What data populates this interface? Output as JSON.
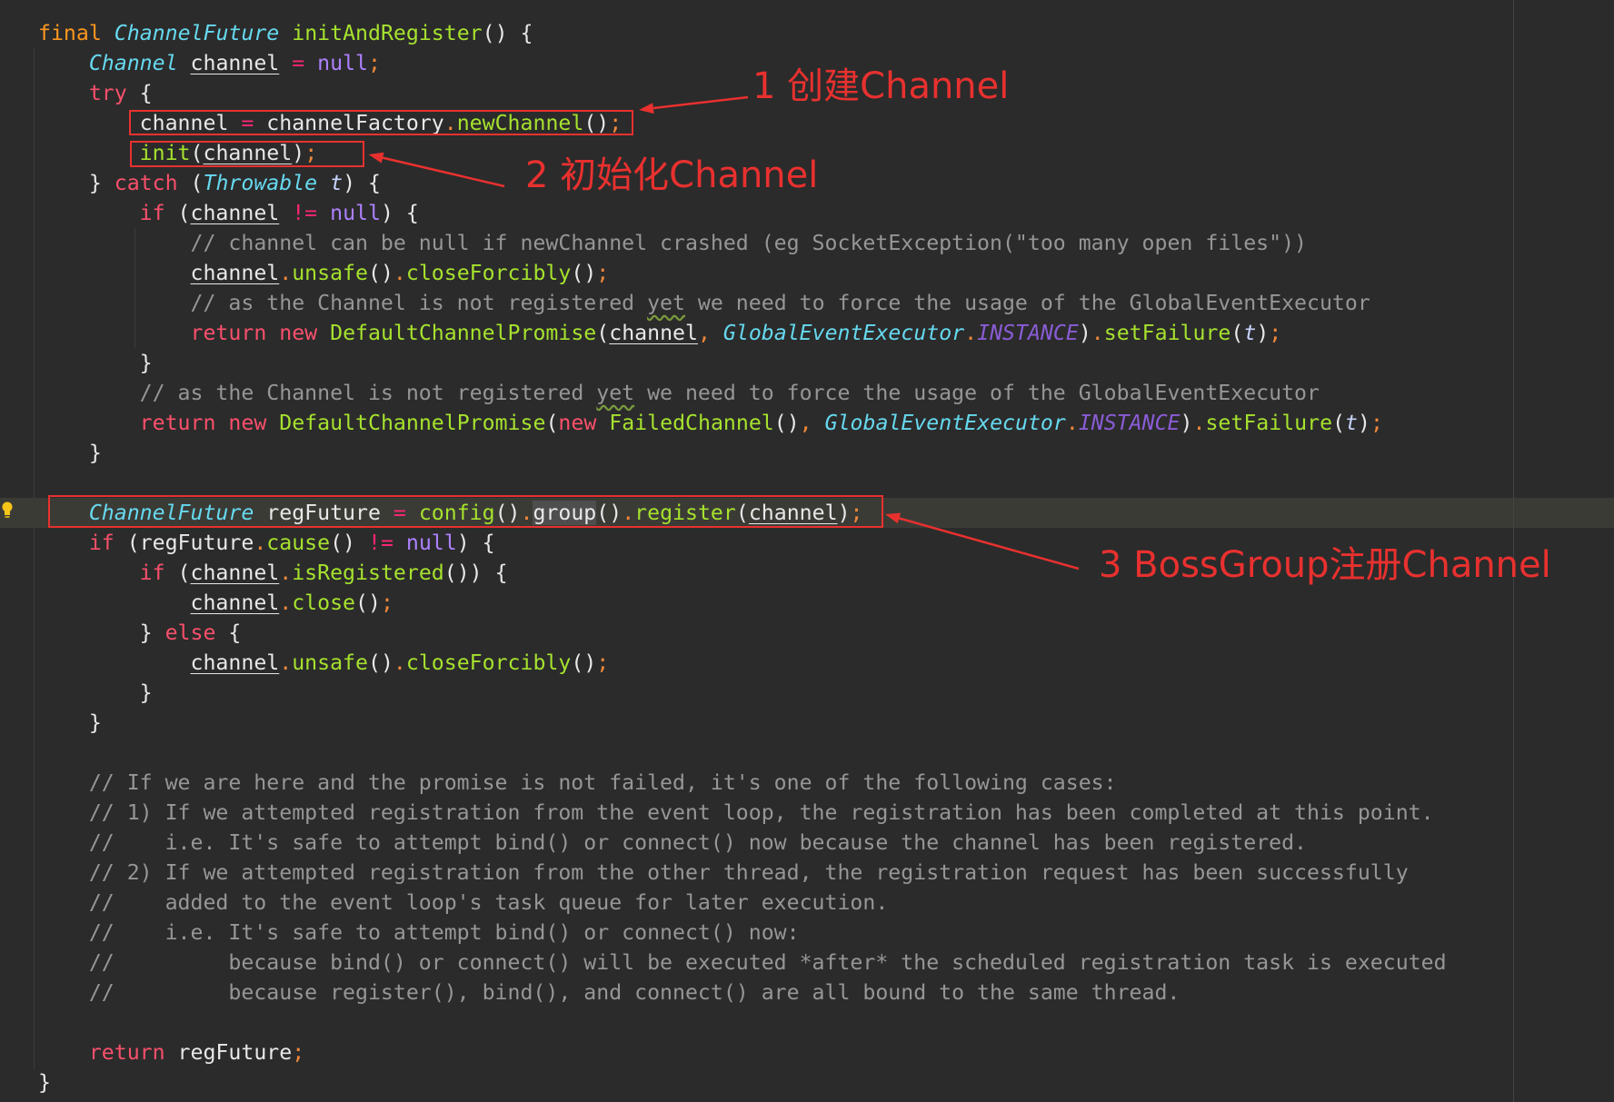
{
  "colors": {
    "background": "#2b2b2b",
    "caret_line": "#3b3b36",
    "text": "#e8e8e8",
    "keyword": "#f9506b",
    "modifier": "#fd971f",
    "type": "#66d9ef",
    "function": "#a6e22e",
    "null": "#ae81ff",
    "constant": "#8a5cd6",
    "operator": "#f92672",
    "punctuation": "#f0883a",
    "comment": "#969696",
    "parameter": "#c8d4ff",
    "annotation": "#e8312f"
  },
  "editor": {
    "lines": [
      {
        "indent": 0,
        "tokens": [
          {
            "text": "final",
            "kind": "mod"
          },
          {
            "text": " ",
            "kind": "plain"
          },
          {
            "text": "ChannelFuture",
            "kind": "type"
          },
          {
            "text": " ",
            "kind": "plain"
          },
          {
            "text": "initAndRegister",
            "kind": "fn"
          },
          {
            "text": "() {",
            "kind": "plain"
          }
        ]
      },
      {
        "indent": 1,
        "tokens": [
          {
            "text": "Channel",
            "kind": "type"
          },
          {
            "text": " ",
            "kind": "plain"
          },
          {
            "text": "channel",
            "kind": "id",
            "underline": true
          },
          {
            "text": " ",
            "kind": "plain"
          },
          {
            "text": "=",
            "kind": "op"
          },
          {
            "text": " ",
            "kind": "plain"
          },
          {
            "text": "null",
            "kind": "null"
          },
          {
            "text": ";",
            "kind": "punc"
          }
        ]
      },
      {
        "indent": 1,
        "tokens": [
          {
            "text": "try",
            "kind": "kw"
          },
          {
            "text": " {",
            "kind": "plain"
          }
        ]
      },
      {
        "indent": 2,
        "tokens": [
          {
            "text": "channel",
            "kind": "id"
          },
          {
            "text": " ",
            "kind": "plain"
          },
          {
            "text": "=",
            "kind": "op"
          },
          {
            "text": " channelFactory",
            "kind": "plain"
          },
          {
            "text": ".",
            "kind": "punc"
          },
          {
            "text": "newChannel",
            "kind": "fn"
          },
          {
            "text": "()",
            "kind": "plain"
          },
          {
            "text": ";",
            "kind": "punc"
          }
        ]
      },
      {
        "indent": 2,
        "tokens": [
          {
            "text": "init",
            "kind": "fn"
          },
          {
            "text": "(",
            "kind": "plain"
          },
          {
            "text": "channel",
            "kind": "id",
            "underline": true
          },
          {
            "text": ")",
            "kind": "plain"
          },
          {
            "text": ";",
            "kind": "punc"
          }
        ]
      },
      {
        "indent": 1,
        "tokens": [
          {
            "text": "} ",
            "kind": "plain"
          },
          {
            "text": "catch",
            "kind": "kw"
          },
          {
            "text": " (",
            "kind": "plain"
          },
          {
            "text": "Throwable",
            "kind": "type"
          },
          {
            "text": " ",
            "kind": "plain"
          },
          {
            "text": "t",
            "kind": "param"
          },
          {
            "text": ") {",
            "kind": "plain"
          }
        ]
      },
      {
        "indent": 2,
        "tokens": [
          {
            "text": "if",
            "kind": "kw"
          },
          {
            "text": " (",
            "kind": "plain"
          },
          {
            "text": "channel",
            "kind": "id",
            "underline": true
          },
          {
            "text": " ",
            "kind": "plain"
          },
          {
            "text": "!=",
            "kind": "op"
          },
          {
            "text": " ",
            "kind": "plain"
          },
          {
            "text": "null",
            "kind": "null"
          },
          {
            "text": ") {",
            "kind": "plain"
          }
        ]
      },
      {
        "indent": 3,
        "tokens": [
          {
            "text": "// channel can be null if newChannel crashed (eg SocketException(\"too many open files\"))",
            "kind": "comment"
          }
        ]
      },
      {
        "indent": 3,
        "tokens": [
          {
            "text": "channel",
            "kind": "id",
            "underline": true
          },
          {
            "text": ".",
            "kind": "punc"
          },
          {
            "text": "unsafe",
            "kind": "fn"
          },
          {
            "text": "()",
            "kind": "plain"
          },
          {
            "text": ".",
            "kind": "punc"
          },
          {
            "text": "closeForcibly",
            "kind": "fn"
          },
          {
            "text": "()",
            "kind": "plain"
          },
          {
            "text": ";",
            "kind": "punc"
          }
        ]
      },
      {
        "indent": 3,
        "tokens": [
          {
            "text": "// as the Channel is not registered ",
            "kind": "comment"
          },
          {
            "text": "yet",
            "kind": "comment",
            "wavy": true
          },
          {
            "text": " we need to force the usage of the GlobalEventExecutor",
            "kind": "comment"
          }
        ]
      },
      {
        "indent": 3,
        "tokens": [
          {
            "text": "return",
            "kind": "kw"
          },
          {
            "text": " ",
            "kind": "plain"
          },
          {
            "text": "new",
            "kind": "kw"
          },
          {
            "text": " ",
            "kind": "plain"
          },
          {
            "text": "DefaultChannelPromise",
            "kind": "fn"
          },
          {
            "text": "(",
            "kind": "plain"
          },
          {
            "text": "channel",
            "kind": "id",
            "underline": true
          },
          {
            "text": ",",
            "kind": "punc"
          },
          {
            "text": " ",
            "kind": "plain"
          },
          {
            "text": "GlobalEventExecutor",
            "kind": "type"
          },
          {
            "text": ".",
            "kind": "punc"
          },
          {
            "text": "INSTANCE",
            "kind": "const"
          },
          {
            "text": ")",
            "kind": "plain"
          },
          {
            "text": ".",
            "kind": "punc"
          },
          {
            "text": "setFailure",
            "kind": "fn"
          },
          {
            "text": "(",
            "kind": "plain"
          },
          {
            "text": "t",
            "kind": "param"
          },
          {
            "text": ")",
            "kind": "plain"
          },
          {
            "text": ";",
            "kind": "punc"
          }
        ]
      },
      {
        "indent": 2,
        "tokens": [
          {
            "text": "}",
            "kind": "plain"
          }
        ]
      },
      {
        "indent": 2,
        "tokens": [
          {
            "text": "// as the Channel is not registered ",
            "kind": "comment"
          },
          {
            "text": "yet",
            "kind": "comment",
            "wavy": true
          },
          {
            "text": " we need to force the usage of the GlobalEventExecutor",
            "kind": "comment"
          }
        ]
      },
      {
        "indent": 2,
        "tokens": [
          {
            "text": "return",
            "kind": "kw"
          },
          {
            "text": " ",
            "kind": "plain"
          },
          {
            "text": "new",
            "kind": "kw"
          },
          {
            "text": " ",
            "kind": "plain"
          },
          {
            "text": "DefaultChannelPromise",
            "kind": "fn"
          },
          {
            "text": "(",
            "kind": "plain"
          },
          {
            "text": "new",
            "kind": "kw"
          },
          {
            "text": " ",
            "kind": "plain"
          },
          {
            "text": "FailedChannel",
            "kind": "fn"
          },
          {
            "text": "()",
            "kind": "plain"
          },
          {
            "text": ",",
            "kind": "punc"
          },
          {
            "text": " ",
            "kind": "plain"
          },
          {
            "text": "GlobalEventExecutor",
            "kind": "type"
          },
          {
            "text": ".",
            "kind": "punc"
          },
          {
            "text": "INSTANCE",
            "kind": "const"
          },
          {
            "text": ")",
            "kind": "plain"
          },
          {
            "text": ".",
            "kind": "punc"
          },
          {
            "text": "setFailure",
            "kind": "fn"
          },
          {
            "text": "(",
            "kind": "plain"
          },
          {
            "text": "t",
            "kind": "param"
          },
          {
            "text": ")",
            "kind": "plain"
          },
          {
            "text": ";",
            "kind": "punc"
          }
        ]
      },
      {
        "indent": 1,
        "tokens": [
          {
            "text": "}",
            "kind": "plain"
          }
        ]
      },
      {
        "indent": 0,
        "tokens": []
      },
      {
        "indent": 1,
        "current": true,
        "tokens": [
          {
            "text": "ChannelFuture",
            "kind": "type"
          },
          {
            "text": " regFuture ",
            "kind": "plain"
          },
          {
            "text": "=",
            "kind": "op"
          },
          {
            "text": " ",
            "kind": "plain"
          },
          {
            "text": "config",
            "kind": "fn"
          },
          {
            "text": "()",
            "kind": "plain"
          },
          {
            "text": ".",
            "kind": "punc"
          },
          {
            "text": "group",
            "kind": "plain",
            "highlight": true
          },
          {
            "text": "()",
            "kind": "plain"
          },
          {
            "text": ".",
            "kind": "punc"
          },
          {
            "text": "register",
            "kind": "fn"
          },
          {
            "text": "(",
            "kind": "plain"
          },
          {
            "text": "channel",
            "kind": "id",
            "underline": true
          },
          {
            "text": ")",
            "kind": "plain"
          },
          {
            "text": ";",
            "kind": "punc"
          }
        ]
      },
      {
        "indent": 1,
        "tokens": [
          {
            "text": "if",
            "kind": "kw"
          },
          {
            "text": " (regFuture",
            "kind": "plain"
          },
          {
            "text": ".",
            "kind": "punc"
          },
          {
            "text": "cause",
            "kind": "fn"
          },
          {
            "text": "()",
            "kind": "plain"
          },
          {
            "text": " ",
            "kind": "plain"
          },
          {
            "text": "!=",
            "kind": "op"
          },
          {
            "text": " ",
            "kind": "plain"
          },
          {
            "text": "null",
            "kind": "null"
          },
          {
            "text": ") {",
            "kind": "plain"
          }
        ]
      },
      {
        "indent": 2,
        "tokens": [
          {
            "text": "if",
            "kind": "kw"
          },
          {
            "text": " (",
            "kind": "plain"
          },
          {
            "text": "channel",
            "kind": "id",
            "underline": true
          },
          {
            "text": ".",
            "kind": "punc"
          },
          {
            "text": "isRegistered",
            "kind": "fn"
          },
          {
            "text": "()) {",
            "kind": "plain"
          }
        ]
      },
      {
        "indent": 3,
        "tokens": [
          {
            "text": "channel",
            "kind": "id",
            "underline": true
          },
          {
            "text": ".",
            "kind": "punc"
          },
          {
            "text": "close",
            "kind": "fn"
          },
          {
            "text": "()",
            "kind": "plain"
          },
          {
            "text": ";",
            "kind": "punc"
          }
        ]
      },
      {
        "indent": 2,
        "tokens": [
          {
            "text": "} ",
            "kind": "plain"
          },
          {
            "text": "else",
            "kind": "kw"
          },
          {
            "text": " {",
            "kind": "plain"
          }
        ]
      },
      {
        "indent": 3,
        "tokens": [
          {
            "text": "channel",
            "kind": "id",
            "underline": true
          },
          {
            "text": ".",
            "kind": "punc"
          },
          {
            "text": "unsafe",
            "kind": "fn"
          },
          {
            "text": "()",
            "kind": "plain"
          },
          {
            "text": ".",
            "kind": "punc"
          },
          {
            "text": "closeForcibly",
            "kind": "fn"
          },
          {
            "text": "()",
            "kind": "plain"
          },
          {
            "text": ";",
            "kind": "punc"
          }
        ]
      },
      {
        "indent": 2,
        "tokens": [
          {
            "text": "}",
            "kind": "plain"
          }
        ]
      },
      {
        "indent": 1,
        "tokens": [
          {
            "text": "}",
            "kind": "plain"
          }
        ]
      },
      {
        "indent": 0,
        "tokens": []
      },
      {
        "indent": 1,
        "tokens": [
          {
            "text": "// If we are here and the promise is not failed, it's one of the following cases:",
            "kind": "comment"
          }
        ]
      },
      {
        "indent": 1,
        "tokens": [
          {
            "text": "// 1) If we attempted registration from the event loop, the registration has been completed at this point.",
            "kind": "comment"
          }
        ]
      },
      {
        "indent": 1,
        "tokens": [
          {
            "text": "//    i.e. It's safe to attempt bind() or connect() now because the channel has been registered.",
            "kind": "comment"
          }
        ]
      },
      {
        "indent": 1,
        "tokens": [
          {
            "text": "// 2) If we attempted registration from the other thread, the registration request has been successfully",
            "kind": "comment"
          }
        ]
      },
      {
        "indent": 1,
        "tokens": [
          {
            "text": "//    added to the event loop's task queue for later execution.",
            "kind": "comment"
          }
        ]
      },
      {
        "indent": 1,
        "tokens": [
          {
            "text": "//    i.e. It's safe to attempt bind() or connect() now:",
            "kind": "comment"
          }
        ]
      },
      {
        "indent": 1,
        "tokens": [
          {
            "text": "//         because bind() or connect() will be executed *after* the scheduled registration task is executed",
            "kind": "comment"
          }
        ]
      },
      {
        "indent": 1,
        "tokens": [
          {
            "text": "//         because register(), bind(), and connect() are all bound to the same thread.",
            "kind": "comment"
          }
        ]
      },
      {
        "indent": 0,
        "tokens": []
      },
      {
        "indent": 1,
        "tokens": [
          {
            "text": "return",
            "kind": "kw"
          },
          {
            "text": " regFuture",
            "kind": "plain"
          },
          {
            "text": ";",
            "kind": "punc"
          }
        ]
      },
      {
        "indent": 0,
        "tokens": [
          {
            "text": "}",
            "kind": "plain"
          }
        ]
      }
    ]
  },
  "annotations": [
    {
      "label": "1 创建Channel"
    },
    {
      "label": "2 初始化Channel"
    },
    {
      "label": "3 BossGroup注册Channel"
    }
  ]
}
